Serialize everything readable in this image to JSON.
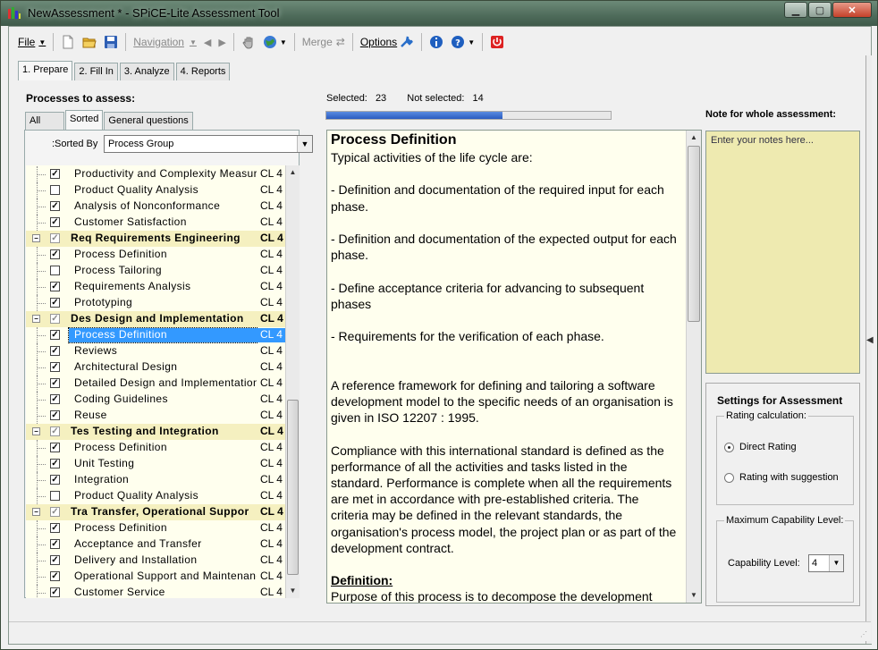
{
  "window": {
    "title": "NewAssessment * - SPiCE-Lite Assessment Tool",
    "buttons": [
      "minimize",
      "maximize",
      "close"
    ]
  },
  "toolbar": {
    "file_label": "File",
    "navigation_label": "Navigation",
    "merge_label": "Merge",
    "options_label": "Options"
  },
  "main_tabs": [
    {
      "label": "1. Prepare",
      "active": true
    },
    {
      "label": "2. Fill In",
      "active": false
    },
    {
      "label": "3. Analyze",
      "active": false
    },
    {
      "label": "4. Reports",
      "active": false
    }
  ],
  "processes": {
    "heading": "Processes to assess:",
    "subtabs": [
      {
        "label": "All",
        "active": false
      },
      {
        "label": "Sorted",
        "active": true
      },
      {
        "label": "General questions",
        "active": false
      }
    ],
    "sort_by_label": ":Sorted By",
    "sort_by_value": "Process Group",
    "rows": [
      {
        "name": "Productivity and Complexity Measur",
        "cl": "CL 4",
        "checked": true,
        "group": false
      },
      {
        "name": "Product Quality Analysis",
        "cl": "CL 4",
        "checked": false,
        "group": false
      },
      {
        "name": "Analysis of Nonconformance",
        "cl": "CL 4",
        "checked": true,
        "group": false
      },
      {
        "name": "Customer Satisfaction",
        "cl": "CL 4",
        "checked": true,
        "group": false
      },
      {
        "name": "Req Requirements Engineering",
        "cl": "CL 4",
        "checked": true,
        "group": true
      },
      {
        "name": "Process Definition",
        "cl": "CL 4",
        "checked": true,
        "group": false
      },
      {
        "name": "Process Tailoring",
        "cl": "CL 4",
        "checked": false,
        "group": false
      },
      {
        "name": "Requirements Analysis",
        "cl": "CL 4",
        "checked": true,
        "group": false
      },
      {
        "name": "Prototyping",
        "cl": "CL 4",
        "checked": true,
        "group": false
      },
      {
        "name": "Des Design and Implementation",
        "cl": "CL 4",
        "checked": true,
        "group": true
      },
      {
        "name": "Process Definition",
        "cl": "CL 4",
        "checked": true,
        "group": false,
        "selected": true
      },
      {
        "name": "Reviews",
        "cl": "CL 4",
        "checked": true,
        "group": false
      },
      {
        "name": "Architectural Design",
        "cl": "CL 4",
        "checked": true,
        "group": false
      },
      {
        "name": "Detailed Design and Implementation",
        "cl": "CL 4",
        "checked": true,
        "group": false
      },
      {
        "name": "Coding Guidelines",
        "cl": "CL 4",
        "checked": true,
        "group": false
      },
      {
        "name": "Reuse",
        "cl": "CL 4",
        "checked": true,
        "group": false
      },
      {
        "name": "Tes Testing and Integration",
        "cl": "CL 4",
        "checked": true,
        "group": true
      },
      {
        "name": "Process Definition",
        "cl": "CL 4",
        "checked": true,
        "group": false
      },
      {
        "name": "Unit Testing",
        "cl": "CL 4",
        "checked": true,
        "group": false
      },
      {
        "name": "Integration",
        "cl": "CL 4",
        "checked": true,
        "group": false
      },
      {
        "name": "Product Quality Analysis",
        "cl": "CL 4",
        "checked": false,
        "group": false
      },
      {
        "name": "Tra Transfer, Operational Suppor",
        "cl": "CL 4",
        "checked": true,
        "group": true
      },
      {
        "name": "Process Definition",
        "cl": "CL 4",
        "checked": true,
        "group": false
      },
      {
        "name": "Acceptance and Transfer",
        "cl": "CL 4",
        "checked": true,
        "group": false
      },
      {
        "name": "Delivery and Installation",
        "cl": "CL 4",
        "checked": true,
        "group": false
      },
      {
        "name": "Operational Support and Maintenanc",
        "cl": "CL 4",
        "checked": true,
        "group": false
      },
      {
        "name": "Customer Service",
        "cl": "CL 4",
        "checked": true,
        "group": false
      }
    ]
  },
  "selection": {
    "selected_label": "Selected:",
    "selected_count": "23",
    "not_selected_label": "Not selected:",
    "not_selected_count": "14",
    "progress_fraction": 0.62
  },
  "description": {
    "title": "Process Definition",
    "paragraphs": [
      "Typical activities of the life cycle are:",
      "",
      "- Definition and documentation of the required input for each phase.",
      "",
      "- Definition and documentation of the expected output for each phase.",
      "",
      "- Define acceptance criteria for advancing to subsequent phases",
      "",
      "- Requirements for the verification of each phase.",
      "",
      "",
      "A reference framework for defining and tailoring a software development model to the specific needs of an organisation is given in ISO 12207 : 1995.",
      "",
      "Compliance with this international standard is defined as the performance of all the activities and tasks listed in the standard.  Performance is complete when all the requirements are met in accordance with pre-established criteria.  The criteria may be defined in the relevant standards, the organisation's process model, the project plan or as part of the development contract.",
      ""
    ],
    "definition_heading": "Definition:",
    "definition_text": "Purpose of this process is to decompose the development"
  },
  "note": {
    "label": "Note for whole assessment:",
    "placeholder": "Enter your notes here..."
  },
  "settings": {
    "title": "Settings for Assessment",
    "rating_label": "Rating calculation:",
    "rating_options": [
      {
        "label": "Direct Rating",
        "selected": true
      },
      {
        "label": "Rating with suggestion",
        "selected": false
      }
    ],
    "max_cap_label": "Maximum Capability Level:",
    "cap_level_label": "Capability Level:",
    "cap_level_value": "4"
  }
}
